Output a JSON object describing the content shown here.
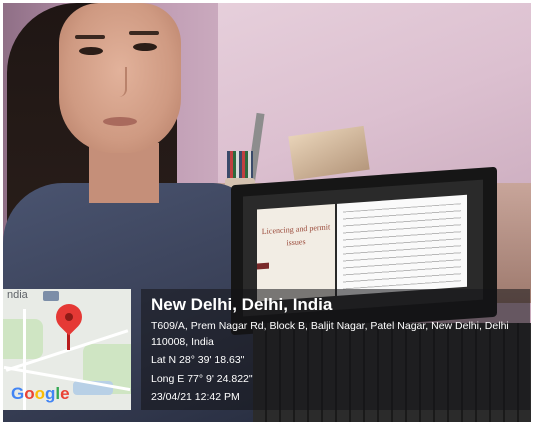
{
  "map": {
    "partial_label": "ndia",
    "logo_text": "Google",
    "logo_colors": [
      "#4285f4",
      "#ea4335",
      "#fbbc05",
      "#4285f4",
      "#34a853",
      "#ea4335"
    ]
  },
  "location": {
    "title": "New Delhi, Delhi, India",
    "address_line1": "T609/A, Prem Nagar Rd, Block B, Baljit Nagar, Patel Nagar, New Delhi, Delhi",
    "address_line2": "110008, India",
    "latitude": "Lat N 28° 39' 18.63\"",
    "longitude": "Long E 77° 9' 24.822\"",
    "datetime": "23/04/21 12:42 PM"
  },
  "laptop_slide": {
    "title": "Licencing and permit issues"
  },
  "colors": {
    "pin": "#e53935",
    "overlay_bg": "rgba(20,20,24,0.55)",
    "text": "#ffffff"
  }
}
